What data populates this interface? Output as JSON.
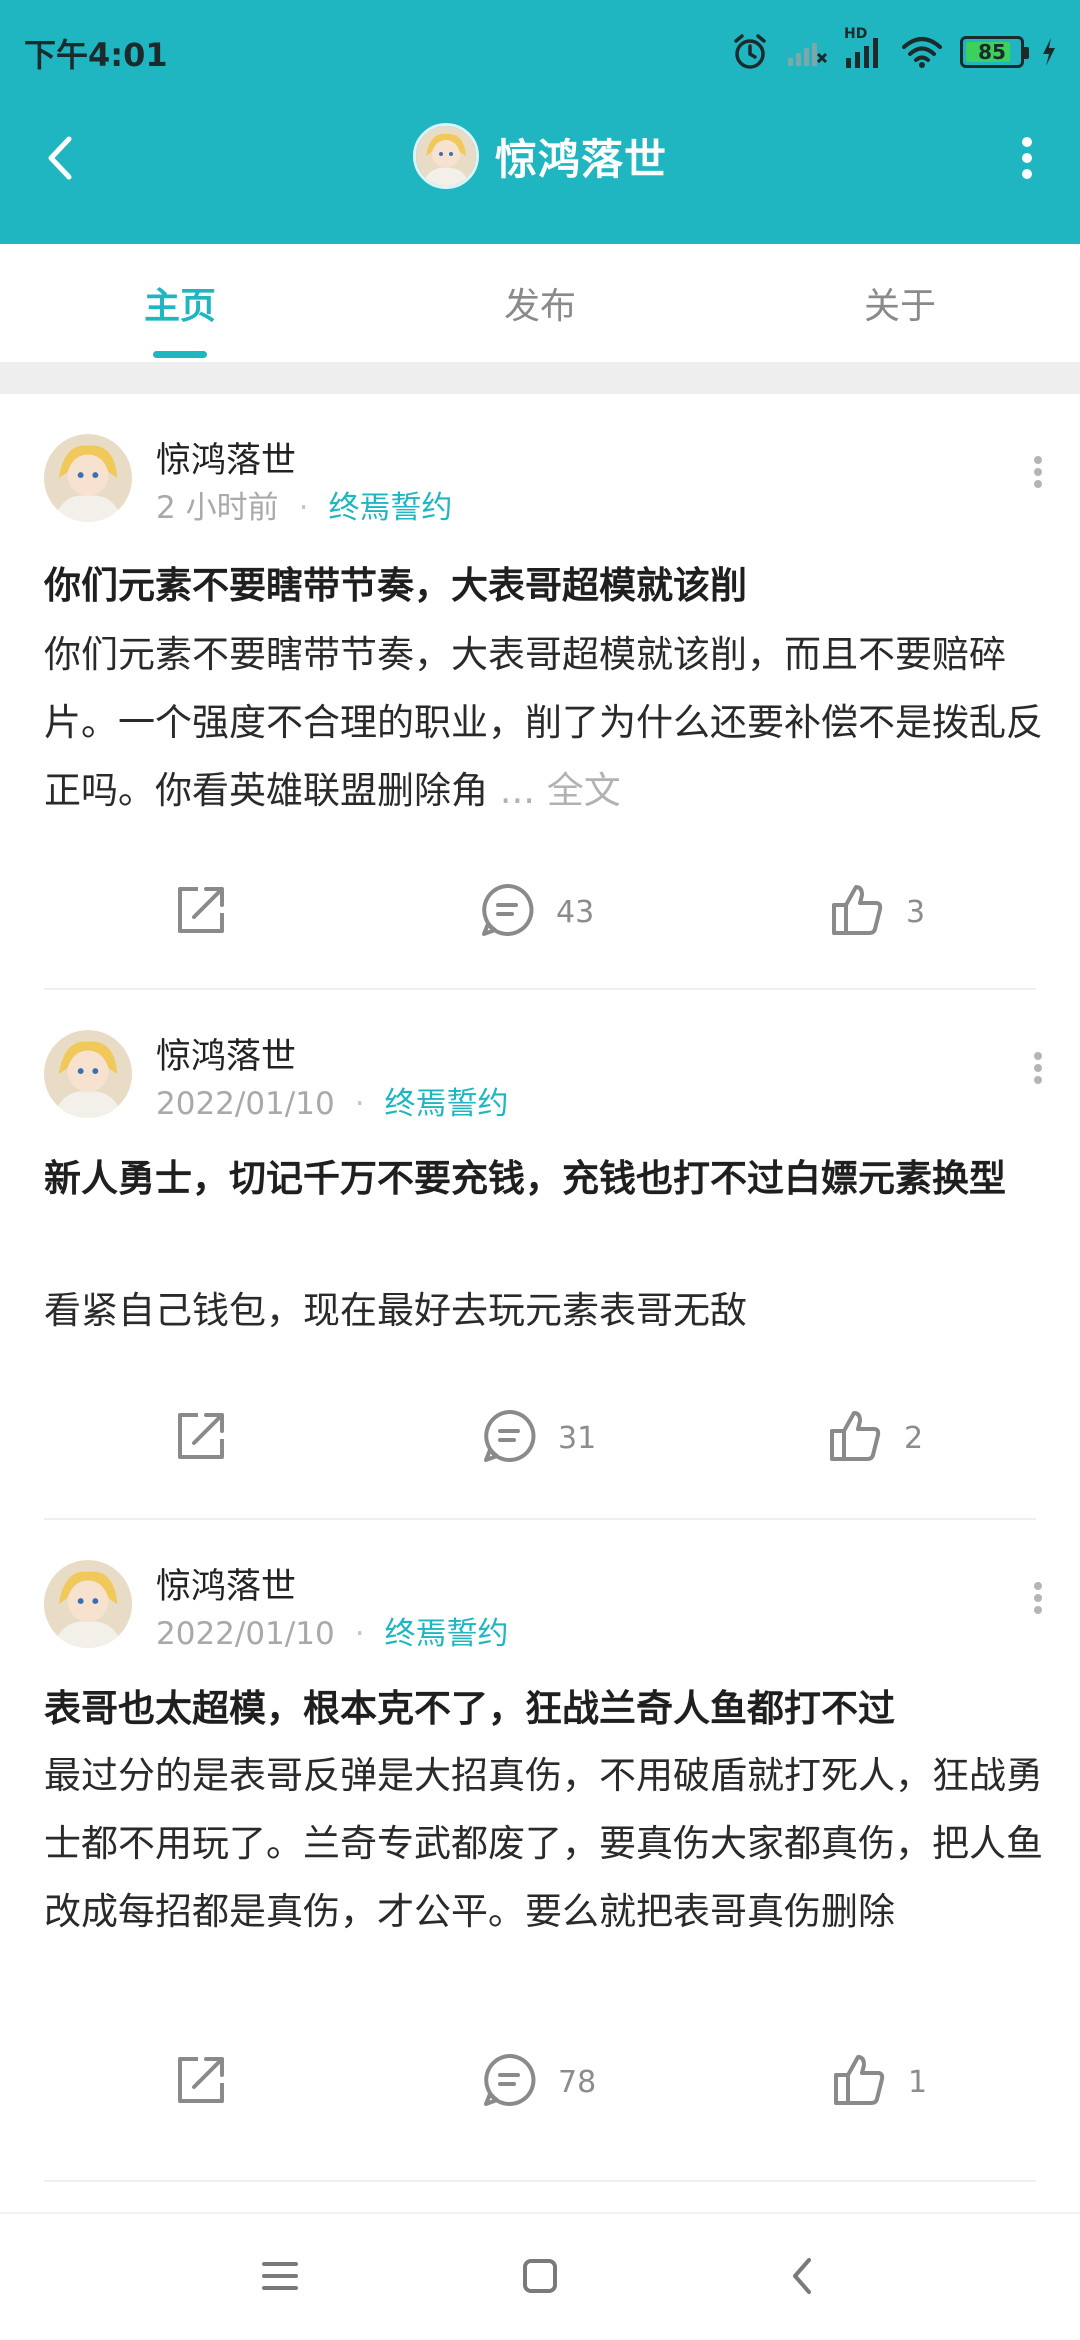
{
  "status_bar": {
    "time": "下午4:01",
    "network_label": "HD",
    "battery_percent": "85",
    "battery_level": 0.85
  },
  "app_bar": {
    "title": "惊鸿落世",
    "back_icon": "back-arrow-icon",
    "more_icon": "more-vertical-icon"
  },
  "tabs": [
    {
      "label": "主页",
      "active": true
    },
    {
      "label": "发布",
      "active": false
    },
    {
      "label": "关于",
      "active": false
    }
  ],
  "posts": [
    {
      "author": "惊鸿落世",
      "time": "2 小时前",
      "topic": "终焉誓约",
      "title": "你们元素不要瞎带节奏，大表哥超模就该削",
      "body": "你们元素不要瞎带节奏，大表哥超模就该削，而且不要赔碎片。一个强度不合理的职业，削了为什么还要补偿不是拨乱反正吗。你看英雄联盟删除角",
      "read_more": "... 全文",
      "comments": "43",
      "likes": "3"
    },
    {
      "author": "惊鸿落世",
      "time": "2022/01/10",
      "topic": "终焉誓约",
      "title": "新人勇士，切记千万不要充钱，充钱也打不过白嫖元素换型",
      "body": "看紧自己钱包，现在最好去玩元素表哥无敌",
      "read_more": "",
      "comments": "31",
      "likes": "2"
    },
    {
      "author": "惊鸿落世",
      "time": "2022/01/10",
      "topic": "终焉誓约",
      "title": "表哥也太超模，根本克不了，狂战兰奇人鱼都打不过",
      "body": "最过分的是表哥反弹是大招真伤，不用破盾就打死人，狂战勇士都不用玩了。兰奇专武都废了，要真伤大家都真伤，把人鱼改成每招都是真伤，才公平。要么就把表哥真伤删除",
      "read_more": "",
      "comments": "78",
      "likes": "1"
    }
  ],
  "colors": {
    "accent": "#1fb6c1",
    "muted": "#a9a9a9"
  },
  "icons": {
    "share": "share-icon",
    "comment": "comment-icon",
    "like": "thumbs-up-icon",
    "nav_menu": "menu-icon",
    "nav_home": "home-square-icon",
    "nav_back": "nav-back-icon"
  }
}
